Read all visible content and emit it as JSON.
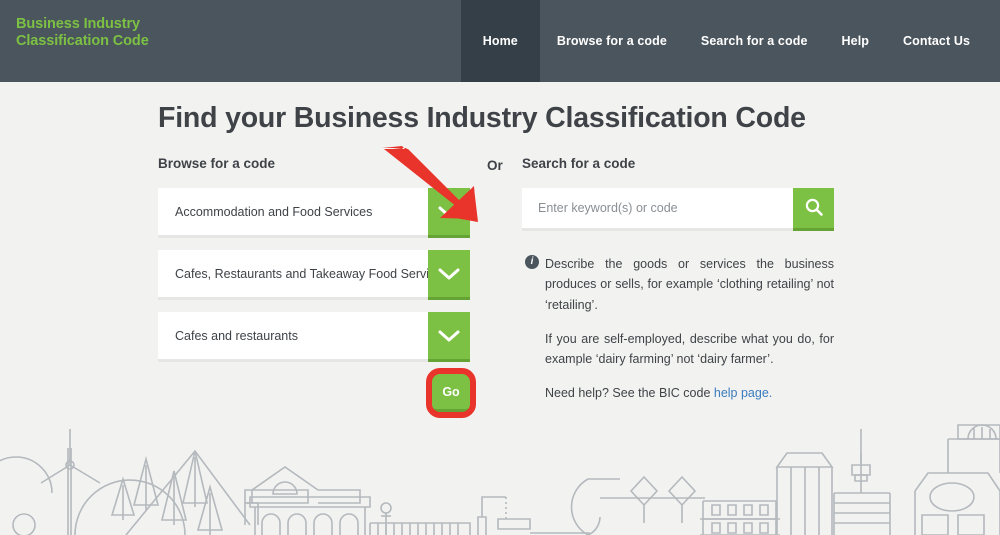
{
  "header": {
    "logo_line1": "Business Industry",
    "logo_line2": "Classification Code",
    "logo_color": "#7cc143",
    "bg_color": "#4b555d",
    "active_bg_color": "#353f47",
    "nav": [
      {
        "label": "Home",
        "active": true
      },
      {
        "label": "Browse for a code",
        "active": false
      },
      {
        "label": "Search for a code",
        "active": false
      },
      {
        "label": "Help",
        "active": false
      },
      {
        "label": "Contact Us",
        "active": false
      }
    ]
  },
  "main": {
    "page_title": "Find your Business Industry Classification Code",
    "or_label": "Or",
    "accent_green": "#7cc143",
    "annotation_red": "#e8342a",
    "browse": {
      "heading": "Browse for a code",
      "selects": [
        {
          "value": "Accommodation and Food Services",
          "icon": "chevron-down-icon"
        },
        {
          "value": "Cafes, Restaurants and Takeaway Food Services",
          "icon": "chevron-down-icon"
        },
        {
          "value": "Cafes and restaurants",
          "icon": "chevron-down-icon"
        }
      ],
      "go_label": "Go"
    },
    "search": {
      "heading": "Search for a code",
      "placeholder": "Enter keyword(s) or code",
      "value": "",
      "button_icon": "search-icon",
      "info_icon": "info-icon",
      "help_line_1": "Describe the goods or services the business produces or sells, for example ‘clothing retailing’ not ‘retailing’.",
      "help_line_2": "If you are self-employed, describe what you do, for example ‘dairy farming’ not ‘dairy farmer’.",
      "help_line_3_prefix": "Need help? See the BIC code ",
      "help_link_label": "help page.",
      "help_link_color": "#3a7cbd"
    }
  },
  "illustration": {
    "name": "cityscape-line-art",
    "stroke_color": "#b4b9bd"
  }
}
